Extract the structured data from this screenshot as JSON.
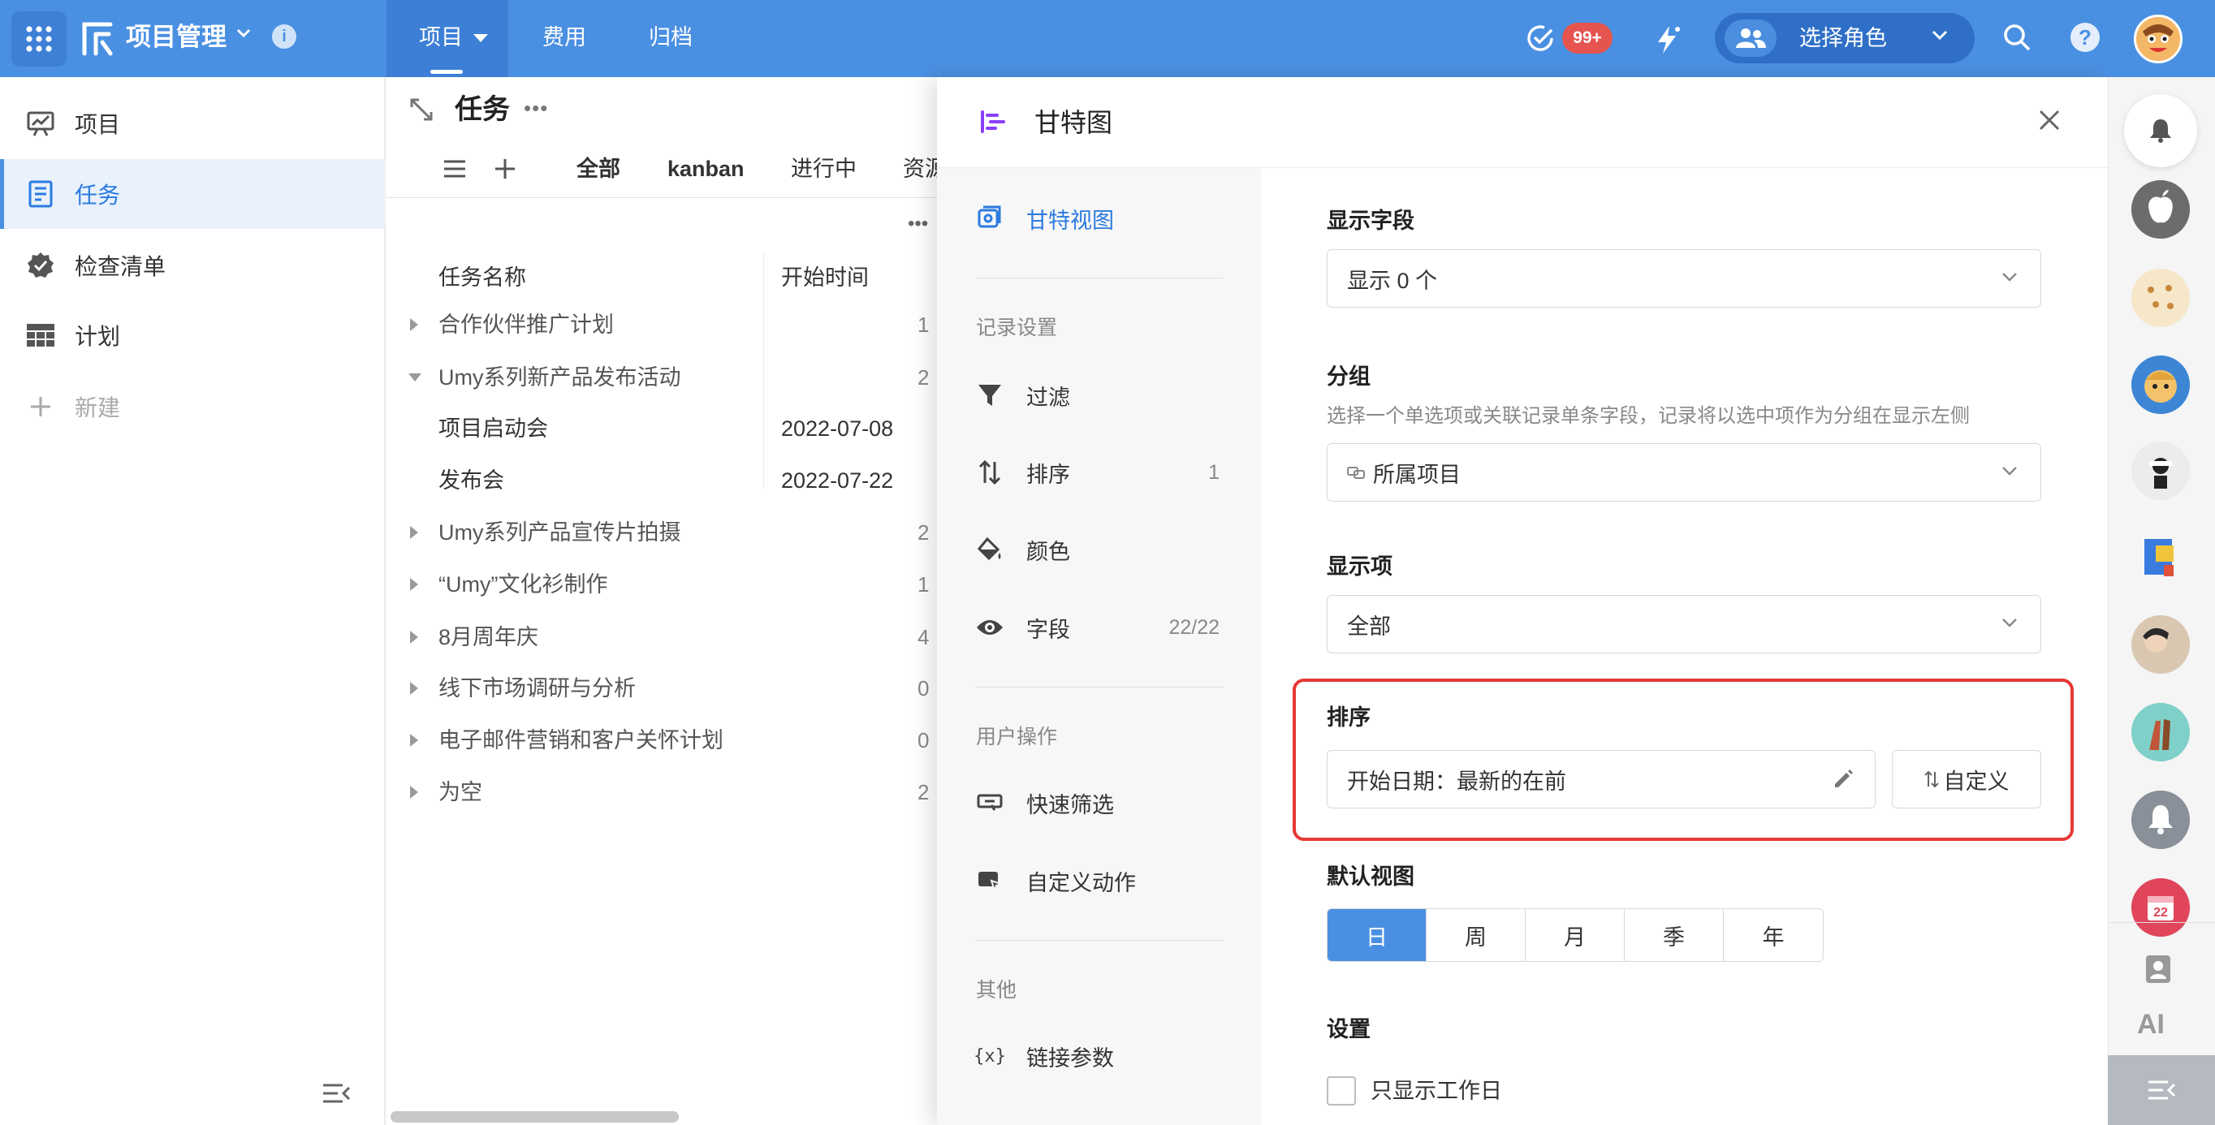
{
  "topbar": {
    "app_name": "项目管理",
    "nav": [
      {
        "label": "项目",
        "active": true
      },
      {
        "label": "费用",
        "active": false
      },
      {
        "label": "归档",
        "active": false
      }
    ],
    "badge": "99+",
    "role_label": "选择角色",
    "accent": "#4a90e2"
  },
  "sidebar": {
    "items": [
      {
        "label": "项目",
        "icon": "presentation-chart-icon"
      },
      {
        "label": "任务",
        "icon": "document-list-icon",
        "active": true
      },
      {
        "label": "检查清单",
        "icon": "check-badge-icon"
      },
      {
        "label": "计划",
        "icon": "table-grid-icon"
      }
    ],
    "new_label": "新建"
  },
  "tasks_panel": {
    "title": "任务",
    "view_tabs": [
      "全部",
      "kanban",
      "进行中",
      "资源"
    ],
    "columns": [
      "任务名称",
      "开始时间"
    ],
    "rows": [
      {
        "name": "合作伙伴推广计划",
        "date": "",
        "count": "1",
        "expanded": false,
        "child": false
      },
      {
        "name": "Umy系列新产品发布活动",
        "date": "",
        "count": "2",
        "expanded": true,
        "child": false
      },
      {
        "name": "项目启动会",
        "date": "2022-07-08",
        "count": "",
        "child": true
      },
      {
        "name": "发布会",
        "date": "2022-07-22",
        "count": "",
        "child": true
      },
      {
        "name": "Umy系列产品宣传片拍摄",
        "date": "",
        "count": "2",
        "expanded": false,
        "child": false
      },
      {
        "name": "“Umy”文化衫制作",
        "date": "",
        "count": "1",
        "expanded": false,
        "child": false
      },
      {
        "name": "8月周年庆",
        "date": "",
        "count": "4",
        "expanded": false,
        "child": false
      },
      {
        "name": "线下市场调研与分析",
        "date": "",
        "count": "0",
        "expanded": false,
        "child": false
      },
      {
        "name": "电子邮件营销和客户关怀计划",
        "date": "",
        "count": "0",
        "expanded": false,
        "child": false
      },
      {
        "name": "为空",
        "date": "",
        "count": "2",
        "expanded": false,
        "child": false
      }
    ]
  },
  "gantt": {
    "title": "甘特图",
    "nav": {
      "view": "甘特视图",
      "record_group": "记录设置",
      "filter": "过滤",
      "sort": "排序",
      "sort_count": "1",
      "color": "颜色",
      "fields": "字段",
      "fields_count": "22/22",
      "user_group": "用户操作",
      "quick_filter": "快速筛选",
      "custom_action": "自定义动作",
      "other_group": "其他",
      "link_params": "链接参数"
    },
    "display_fields": {
      "label": "显示字段",
      "value": "显示 0 个"
    },
    "group": {
      "label": "分组",
      "desc": "选择一个单选项或关联记录单条字段，记录将以选中项作为分组在显示左侧",
      "value": "所属项目"
    },
    "display_items": {
      "label": "显示项",
      "value": "全部"
    },
    "sort": {
      "label": "排序",
      "value": "开始日期：最新的在前",
      "custom_label": "自定义"
    },
    "default_view": {
      "label": "默认视图",
      "options": [
        "日",
        "周",
        "月",
        "季",
        "年"
      ],
      "selected": "日"
    },
    "settings": {
      "label": "设置",
      "workday_only": "只显示工作日"
    }
  },
  "rail": {
    "ai_label": "AI",
    "calendar_day": "22"
  }
}
